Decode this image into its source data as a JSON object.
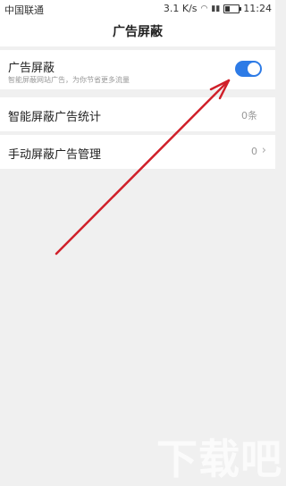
{
  "status_bar": {
    "carrier": "中国联通",
    "speed": "3.1 K/s",
    "time": "11:24",
    "icons": [
      "wifi-icon",
      "signal-icon",
      "battery-icon"
    ]
  },
  "header": {
    "title": "广告屏蔽"
  },
  "settings": {
    "ad_block": {
      "title": "广告屏蔽",
      "subtitle": "智能屏蔽网站广告，为你节省更多流量",
      "enabled": true
    },
    "stats": {
      "label": "智能屏蔽广告统计",
      "value": "0条"
    },
    "manual": {
      "label": "手动屏蔽广告管理",
      "value": "0"
    }
  },
  "colors": {
    "accent": "#2d7be6",
    "arrow": "#d0202a",
    "background": "#f0f0f0"
  },
  "watermark": "下载吧"
}
